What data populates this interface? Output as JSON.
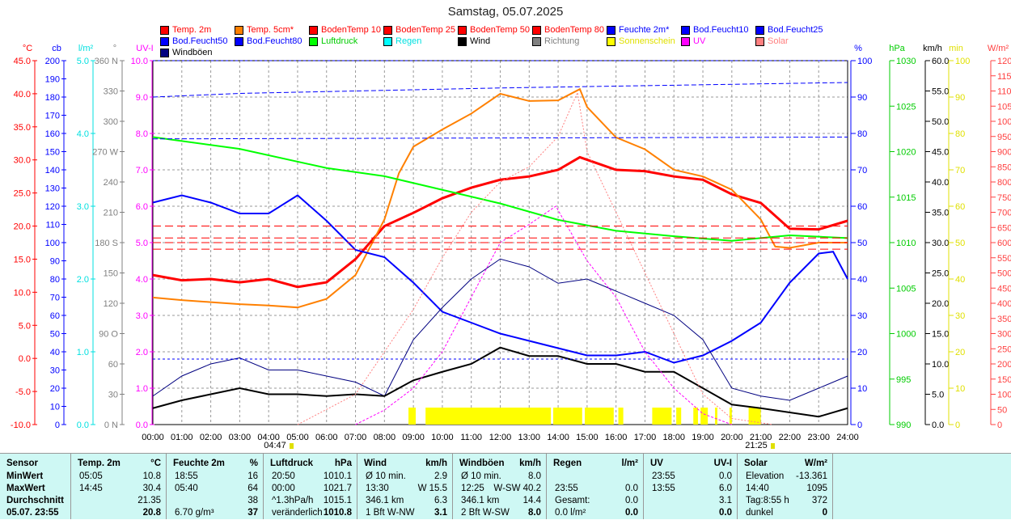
{
  "title": "Samstag, 05.07.2025",
  "legend": [
    {
      "label": "Temp. 2m",
      "color": "#ff0000",
      "text": "#ff0000"
    },
    {
      "label": "Temp. 5cm*",
      "color": "#ff8000",
      "text": "#ff0000"
    },
    {
      "label": "BodenTemp 10",
      "color": "#ff0000",
      "text": "#ff0000"
    },
    {
      "label": "BodenTemp 25",
      "color": "#ff0000",
      "text": "#ff0000"
    },
    {
      "label": "BodenTemp 50",
      "color": "#ff0000",
      "text": "#ff0000"
    },
    {
      "label": "BodenTemp 80",
      "color": "#ff0000",
      "text": "#ff0000"
    },
    {
      "label": "Feuchte 2m*",
      "color": "#0000ff",
      "text": "#0000ff"
    },
    {
      "label": "Bod.Feucht10",
      "color": "#0000ff",
      "text": "#0000ff"
    },
    {
      "label": "Bod.Feucht25",
      "color": "#0000ff",
      "text": "#0000ff"
    },
    {
      "label": "Bod.Feucht50",
      "color": "#0000ff",
      "text": "#0000ff"
    },
    {
      "label": "Bod.Feucht80",
      "color": "#0000ff",
      "text": "#0000ff"
    },
    {
      "label": "Luftdruck",
      "color": "#00ff00",
      "text": "#00cc00"
    },
    {
      "label": "Regen",
      "color": "#00ffff",
      "text": "#00e0e0"
    },
    {
      "label": "Wind",
      "color": "#000000",
      "text": "#000000"
    },
    {
      "label": "Richtung",
      "color": "#808080",
      "text": "#808080"
    },
    {
      "label": "Sonnenschein",
      "color": "#ffff00",
      "text": "#e0e000"
    },
    {
      "label": "UV",
      "color": "#ff00ff",
      "text": "#ff00ff"
    },
    {
      "label": "Solar",
      "color": "#ff8080",
      "text": "#ff8080"
    },
    {
      "label": "Windböen",
      "color": "#000080",
      "text": "#000000"
    }
  ],
  "chart_data": {
    "type": "line",
    "title": "Samstag, 05.07.2025",
    "x_ticks": [
      "00:00",
      "01:00",
      "02:00",
      "03:00",
      "04:00",
      "05:00",
      "06:00",
      "07:00",
      "08:00",
      "09:00",
      "10:00",
      "11:00",
      "12:00",
      "13:00",
      "14:00",
      "15:00",
      "16:00",
      "17:00",
      "18:00",
      "19:00",
      "20:00",
      "21:00",
      "22:00",
      "23:00",
      "24:00"
    ],
    "sunrise": "04:47",
    "sunset": "21:25",
    "axes": [
      {
        "unit": "°C",
        "color": "#ff0000",
        "range": [
          -10,
          45
        ],
        "ticks": [
          "-10.0",
          "-5.0",
          "0.0",
          "5.0",
          "10.0",
          "15.0",
          "20.0",
          "25.0",
          "30.0",
          "35.0",
          "40.0",
          "45.0"
        ]
      },
      {
        "unit": "cb",
        "color": "#0000ff",
        "range": [
          0,
          200
        ],
        "ticks": [
          "0",
          "10",
          "20",
          "30",
          "40",
          "50",
          "60",
          "70",
          "80",
          "90",
          "100",
          "110",
          "120",
          "130",
          "140",
          "150",
          "160",
          "170",
          "180",
          "190",
          "200"
        ]
      },
      {
        "unit": "l/m²",
        "color": "#00e0e0",
        "range": [
          0,
          5
        ],
        "ticks": [
          "0.0",
          "1.0",
          "2.0",
          "3.0",
          "4.0",
          "5.0"
        ]
      },
      {
        "unit": "°",
        "color": "#808080",
        "range": [
          0,
          360
        ],
        "ticks": [
          "0 N",
          "30",
          "60",
          "90 O",
          "120",
          "150",
          "180 S",
          "210",
          "240",
          "270 W",
          "300",
          "330",
          "360 N"
        ]
      },
      {
        "unit": "UV-I",
        "color": "#ff00ff",
        "range": [
          0,
          10
        ],
        "ticks": [
          "0.0",
          "1.0",
          "2.0",
          "3.0",
          "4.0",
          "5.0",
          "6.0",
          "7.0",
          "8.0",
          "9.0",
          "10.0"
        ]
      },
      {
        "unit": "%",
        "color": "#0000ff",
        "range": [
          0,
          100
        ],
        "ticks": [
          "0",
          "10",
          "20",
          "30",
          "40",
          "50",
          "60",
          "70",
          "80",
          "90",
          "100"
        ]
      },
      {
        "unit": "hPa",
        "color": "#00cc00",
        "range": [
          990,
          1030
        ],
        "ticks": [
          "990",
          "995",
          "1000",
          "1005",
          "1010",
          "1015",
          "1020",
          "1025",
          "1030"
        ]
      },
      {
        "unit": "km/h",
        "color": "#000000",
        "range": [
          0,
          60
        ],
        "ticks": [
          "0.0",
          "5.0",
          "10.0",
          "15.0",
          "20.0",
          "25.0",
          "30.0",
          "35.0",
          "40.0",
          "45.0",
          "50.0",
          "55.0",
          "60.0"
        ]
      },
      {
        "unit": "min",
        "color": "#e0e000",
        "range": [
          0,
          100
        ],
        "ticks": [
          "0",
          "10",
          "20",
          "30",
          "40",
          "50",
          "60",
          "70",
          "80",
          "90",
          "100"
        ]
      },
      {
        "unit": "W/m²",
        "color": "#ff4040",
        "range": [
          0,
          1200
        ],
        "ticks": [
          "0",
          "50",
          "100",
          "150",
          "200",
          "250",
          "300",
          "350",
          "400",
          "450",
          "500",
          "550",
          "600",
          "650",
          "700",
          "750",
          "800",
          "850",
          "900",
          "950",
          "1000",
          "1050",
          "1100",
          "1150",
          "1200"
        ]
      }
    ],
    "series": [
      {
        "name": "Temp. 2m",
        "axis": 0,
        "color": "#ff0000",
        "width": 3,
        "x": [
          0,
          1,
          2,
          3,
          4,
          5,
          6,
          7,
          8,
          9,
          10,
          11,
          12,
          13,
          14,
          14.75,
          16,
          17,
          18,
          19,
          20,
          21,
          22,
          23,
          24
        ],
        "y": [
          12.6,
          11.8,
          12,
          11.5,
          12,
          10.8,
          11.5,
          15,
          20,
          22,
          24.2,
          25.8,
          27,
          27.5,
          28.5,
          30.4,
          28.5,
          28.3,
          27.5,
          27,
          24.8,
          23.5,
          19.6,
          19.5,
          20.8
        ]
      },
      {
        "name": "Temp. 5cm*",
        "axis": 0,
        "color": "#ff8000",
        "width": 2,
        "x": [
          0,
          1,
          2,
          3,
          4,
          5,
          6,
          7,
          8,
          8.5,
          9,
          10,
          11,
          12,
          13,
          14,
          14.75,
          15,
          16,
          17,
          18,
          19,
          20,
          21,
          21.5,
          22,
          23,
          24
        ],
        "y": [
          9.2,
          8.8,
          8.5,
          8.2,
          8,
          7.7,
          9,
          12.6,
          21,
          28,
          32,
          34.6,
          37,
          40,
          38.9,
          39,
          40.7,
          38,
          33.4,
          31.6,
          28.5,
          27.5,
          25.5,
          21,
          16.9,
          16.7,
          17.5,
          17.5
        ]
      },
      {
        "name": "Feuchte 2m*",
        "axis": 5,
        "color": "#0000ff",
        "width": 2,
        "x": [
          0,
          1,
          2,
          3,
          4,
          5,
          6,
          7,
          8,
          9,
          10,
          11,
          12,
          13,
          14,
          15,
          16,
          17,
          18,
          19,
          20,
          21,
          22,
          23,
          23.5,
          24
        ],
        "y": [
          61,
          63,
          61,
          58,
          58,
          63,
          56,
          48,
          46,
          39,
          31,
          28,
          25,
          23,
          21,
          19,
          19,
          20,
          17,
          19,
          23,
          28,
          39,
          47,
          47.5,
          40
        ]
      },
      {
        "name": "Luftdruck",
        "axis": 6,
        "color": "#00ff00",
        "width": 2,
        "x": [
          0,
          3,
          6,
          8,
          10,
          12,
          14,
          16,
          18,
          20,
          22,
          24
        ],
        "y": [
          1021.6,
          1020.3,
          1018.2,
          1017.3,
          1015.8,
          1014.3,
          1012.5,
          1011.3,
          1010.7,
          1010.2,
          1010.8,
          1010.5
        ]
      },
      {
        "name": "Windböen",
        "axis": 7,
        "color": "#000080",
        "width": 1,
        "x": [
          0,
          1,
          2,
          3,
          4,
          5,
          6,
          7,
          8,
          9,
          10,
          11,
          12,
          13,
          14,
          15,
          16,
          17,
          18,
          19,
          20,
          21,
          22,
          23,
          24
        ],
        "y": [
          4.7,
          8,
          10,
          11,
          9,
          9,
          8,
          7,
          4.7,
          14,
          19.3,
          24,
          27.3,
          26,
          23.3,
          24,
          22,
          20,
          18,
          14,
          6,
          4.7,
          4,
          6,
          8
        ]
      },
      {
        "name": "Wind",
        "axis": 7,
        "color": "#000000",
        "width": 2,
        "x": [
          0,
          1,
          2,
          3,
          4,
          5,
          6,
          7,
          8,
          9,
          10,
          11,
          12,
          13,
          14,
          15,
          16,
          17,
          18,
          19,
          20,
          21,
          22,
          23,
          24
        ],
        "y": [
          2.7,
          4,
          5,
          6,
          5,
          5,
          4.7,
          5,
          4.7,
          7.3,
          8.7,
          10,
          12.7,
          11.3,
          11.3,
          10,
          10,
          8.7,
          8.7,
          6,
          3.3,
          2.7,
          2,
          1.3,
          2.7
        ]
      },
      {
        "name": "Solar",
        "axis": 9,
        "color": "#ff8080",
        "width": 1,
        "dash": "2,2",
        "x": [
          5,
          7,
          9,
          10,
          11,
          12,
          13,
          14,
          14.67,
          15,
          16,
          17,
          18,
          19,
          20,
          21.42
        ],
        "y": [
          0,
          100,
          380,
          550,
          700,
          800,
          850,
          950,
          1095,
          900,
          700,
          500,
          300,
          100,
          20,
          0
        ]
      },
      {
        "name": "UV",
        "axis": 4,
        "color": "#ff00ff",
        "width": 1,
        "dash": "3,2",
        "x": [
          7,
          8,
          9,
          10,
          11,
          12,
          13,
          13.92,
          15,
          16,
          17,
          18,
          19,
          20
        ],
        "y": [
          0,
          0.4,
          1,
          2,
          3.5,
          5,
          5.5,
          6,
          4.5,
          3.5,
          2,
          1,
          0.3,
          0
        ]
      },
      {
        "name": "BodenTemp 10",
        "axis": 0,
        "color": "#ff0000",
        "width": 1,
        "dash": "10,5",
        "x": [
          0,
          24
        ],
        "y": [
          20,
          20
        ]
      },
      {
        "name": "BodenTemp 25",
        "axis": 0,
        "color": "#ff0000",
        "width": 1,
        "dash": "10,5",
        "x": [
          0,
          24
        ],
        "y": [
          18.2,
          18.2
        ]
      },
      {
        "name": "BodenTemp 50",
        "axis": 0,
        "color": "#ff0000",
        "width": 1,
        "dash": "10,5",
        "x": [
          0,
          24
        ],
        "y": [
          17.5,
          17.5
        ]
      },
      {
        "name": "BodenTemp 80",
        "axis": 0,
        "color": "#ff0000",
        "width": 1,
        "dash": "10,5",
        "x": [
          0,
          24
        ],
        "y": [
          16.5,
          16.5
        ]
      },
      {
        "name": "Bod.Feucht10",
        "axis": 5,
        "color": "#0000ff",
        "width": 1,
        "dash": "6,3",
        "x": [
          0,
          3,
          12,
          24
        ],
        "y": [
          90,
          91,
          92.5,
          94
        ]
      },
      {
        "name": "Bod.Feucht25",
        "axis": 5,
        "color": "#0000ff",
        "width": 1,
        "dash": "6,3",
        "x": [
          0,
          24
        ],
        "y": [
          78.5,
          79
        ]
      },
      {
        "name": "Bod.Feucht50",
        "axis": 5,
        "color": "#0000ff",
        "width": 1,
        "dash": "3,3",
        "x": [
          0,
          24
        ],
        "y": [
          100,
          100
        ]
      },
      {
        "name": "Bod.Feucht80",
        "axis": 5,
        "color": "#0000ff",
        "width": 1,
        "dash": "3,3",
        "x": [
          0,
          24
        ],
        "y": [
          18,
          18
        ]
      }
    ],
    "sunshine_intervals": [
      [
        8.83,
        9.08
      ],
      [
        9.42,
        13.75
      ],
      [
        13.83,
        14.83
      ],
      [
        14.92,
        15.92
      ],
      [
        16.08,
        16.25
      ],
      [
        17.25,
        17.92
      ],
      [
        18.08,
        18.25
      ],
      [
        18.67,
        18.83
      ],
      [
        18.92,
        19.17
      ],
      [
        19.42,
        19.5
      ],
      [
        19.92,
        20
      ],
      [
        20.58,
        21
      ]
    ]
  },
  "table": {
    "headers": [
      [
        "Sensor",
        ""
      ],
      [
        "Temp. 2m",
        "°C"
      ],
      [
        "Feuchte 2m",
        "%"
      ],
      [
        "Luftdruck",
        "hPa"
      ],
      [
        "Wind",
        "km/h"
      ],
      [
        "Windböen",
        "km/h"
      ],
      [
        "Regen",
        "l/m²"
      ],
      [
        "UV",
        "UV-I"
      ],
      [
        "Solar",
        "W/m²"
      ]
    ],
    "row_labels": [
      "MinWert",
      "MaxWert",
      "Durchschnitt",
      "05.07. 23:55"
    ],
    "cells": [
      [
        [
          "05:05",
          "10.8"
        ],
        [
          "14:45",
          "30.4"
        ],
        [
          "",
          "21.35"
        ],
        [
          "",
          "20.8"
        ]
      ],
      [
        [
          "18:55",
          "16"
        ],
        [
          "05:40",
          "64"
        ],
        [
          "",
          "38"
        ],
        [
          "6.70 g/m³",
          "37"
        ]
      ],
      [
        [
          "20:50",
          "1010.1"
        ],
        [
          "00:00",
          "1021.7"
        ],
        [
          "^1.3hPa/h",
          "1015.1"
        ],
        [
          "veränderlich",
          "1010.8"
        ]
      ],
      [
        [
          "Ø 10 min.",
          "2.9"
        ],
        [
          "13:30",
          "W 15.5"
        ],
        [
          "346.1 km",
          "6.3"
        ],
        [
          "1 Bft W-NW",
          "3.1"
        ]
      ],
      [
        [
          "Ø 10 min.",
          "8.0"
        ],
        [
          "12:25",
          "W-SW 40.2"
        ],
        [
          "346.1 km",
          "14.4"
        ],
        [
          "2 Bft W-SW",
          "8.0"
        ]
      ],
      [
        [
          "",
          ""
        ],
        [
          "23:55",
          "0.0"
        ],
        [
          "Gesamt:",
          "0.0"
        ],
        [
          "0.0 l/m²",
          "0.0"
        ]
      ],
      [
        [
          "23:55",
          "0.0"
        ],
        [
          "13:55",
          "6.0"
        ],
        [
          "",
          "3.1"
        ],
        [
          "",
          "0.0"
        ]
      ],
      [
        [
          "Elevation",
          "-13.361"
        ],
        [
          "14:40",
          "1095"
        ],
        [
          "Tag:8:55 h",
          "372"
        ],
        [
          "dunkel",
          "0"
        ]
      ]
    ]
  }
}
